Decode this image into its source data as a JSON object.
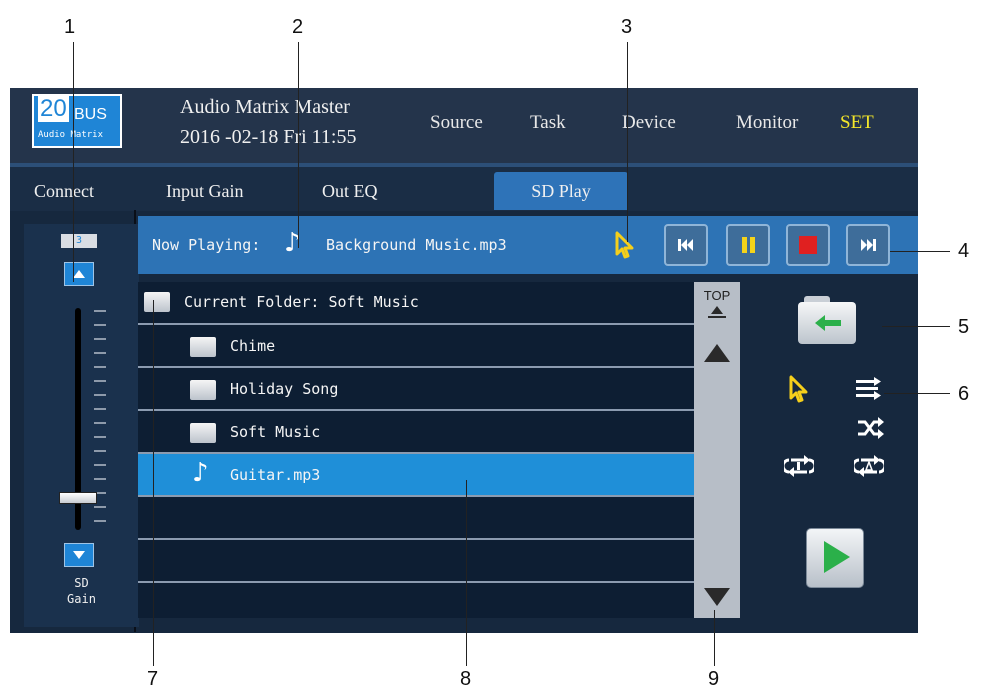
{
  "callouts": [
    "1",
    "2",
    "3",
    "4",
    "5",
    "6",
    "7",
    "8",
    "9"
  ],
  "logo": {
    "number": "20",
    "bus": "BUS",
    "subtitle": "Audio Matrix"
  },
  "header": {
    "title": "Audio Matrix Master",
    "datetime": "2016 -02-18  Fri  11:55"
  },
  "nav": {
    "items": [
      "Source",
      "Task",
      "Device",
      "Monitor",
      "SET"
    ],
    "active_color": "#f5e72a"
  },
  "tabs": [
    "Connect",
    "Input Gain",
    "Out EQ",
    "SD Play"
  ],
  "left_panel": {
    "level_value": "3",
    "label_line1": "SD",
    "label_line2": "Gain"
  },
  "now_playing": {
    "label": "Now Playing:",
    "file": "Background Music.mp3",
    "note_icon": "music-note-icon",
    "pointer_icon": "pointer-icon"
  },
  "controls": [
    "previous-icon",
    "pause-icon",
    "stop-icon",
    "next-icon"
  ],
  "list": {
    "current_folder_label": "Current Folder: Soft Music",
    "items": [
      {
        "type": "folder",
        "name": "Chime"
      },
      {
        "type": "folder",
        "name": "Holiday Song"
      },
      {
        "type": "folder",
        "name": "Soft Music"
      },
      {
        "type": "file",
        "name": "Guitar.mp3",
        "selected": true
      }
    ],
    "empty_rows": 3
  },
  "scrollbar": {
    "top_label": "TOP"
  },
  "colors": {
    "accent": "#2e73b8",
    "selected": "#1f8fd8",
    "play": "#2bb04a",
    "stop": "#e02020",
    "pause": "#f4d31a",
    "pointer": "#f5cf1b"
  }
}
